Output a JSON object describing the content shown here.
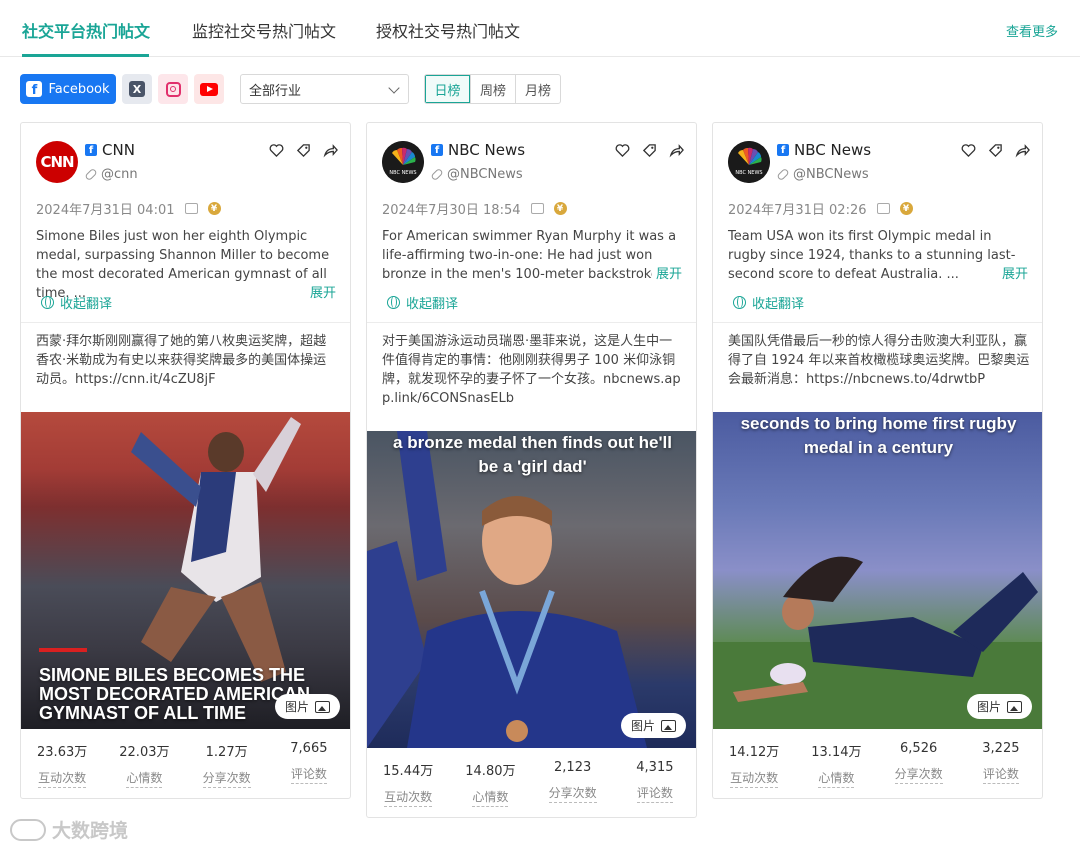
{
  "tabs": [
    {
      "label": "社交平台热门帖文",
      "active": true
    },
    {
      "label": "监控社交号热门帖文",
      "active": false
    },
    {
      "label": "授权社交号热门帖文",
      "active": false
    }
  ],
  "view_more": "查看更多",
  "platforms": {
    "facebook_label": "Facebook",
    "icons": [
      "facebook-icon",
      "x-icon",
      "instagram-icon",
      "youtube-icon"
    ],
    "selected": "Facebook"
  },
  "industry_select": {
    "value": "全部行业"
  },
  "periods": [
    "日榜",
    "周榜",
    "月榜"
  ],
  "active_period": "日榜",
  "posts": [
    {
      "account": "CNN",
      "avatar_text": "CNN",
      "handle": "@cnn",
      "datetime": "2024年7月31日 04:01",
      "text_en": "Simone Biles just won her eighth Olympic medal, surpassing Shannon Miller to become the most decorated American gymnast of all time. ...",
      "expand": "展开",
      "translate_toggle": "收起翻译",
      "text_zh": "西蒙·拜尔斯刚刚赢得了她的第八枚奥运奖牌，超越香农·米勒成为有史以来获得奖牌最多的美国体操运动员。https://cnn.it/4cZU8jF",
      "image_caption": "SIMONE BILES BECOMES THE MOST DECORATED AMERICAN GYMNAST OF ALL TIME",
      "image_badge": "图片",
      "stats": [
        {
          "value": "23.63万",
          "label": "互动次数"
        },
        {
          "value": "22.03万",
          "label": "心情数"
        },
        {
          "value": "1.27万",
          "label": "分享次数"
        },
        {
          "value": "7,665",
          "label": "评论数"
        }
      ]
    },
    {
      "account": "NBC News",
      "avatar_text": "NBC NEWS",
      "handle": "@NBCNews",
      "datetime": "2024年7月30日 18:54",
      "text_en": "For American swimmer Ryan Murphy it was a life-affirming two-in-one: He had just won bronze in the men's 100-meter backstroke when he f",
      "expand": "展开",
      "translate_toggle": "收起翻译",
      "text_zh": "对于美国游泳运动员瑞恩·墨菲来说，这是人生中一件值得肯定的事情：他刚刚获得男子 100 米仰泳铜牌，就发现怀孕的妻子怀了一个女孩。nbcnews.app.link/6CONSnasELb",
      "image_caption": "a bronze medal then finds out he'll be a 'girl dad'",
      "image_badge": "图片",
      "stats": [
        {
          "value": "15.44万",
          "label": "互动次数"
        },
        {
          "value": "14.80万",
          "label": "心情数"
        },
        {
          "value": "2,123",
          "label": "分享次数"
        },
        {
          "value": "4,315",
          "label": "评论数"
        }
      ]
    },
    {
      "account": "NBC News",
      "avatar_text": "NBC NEWS",
      "handle": "@NBCNews",
      "datetime": "2024年7月31日 02:26",
      "text_en": "Team USA won its first Olympic medal in rugby since 1924, thanks to a stunning last-second score to defeat Australia. ...",
      "expand": "展开",
      "translate_toggle": "收起翻译",
      "text_zh": "美国队凭借最后一秒的惊人得分击败澳大利亚队，赢得了自 1924 年以来首枚橄榄球奥运奖牌。巴黎奥运会最新消息：https://nbcnews.to/4drwtbP",
      "image_caption": "seconds to bring home first rugby medal in a century",
      "image_badge": "图片",
      "stats": [
        {
          "value": "14.12万",
          "label": "互动次数"
        },
        {
          "value": "13.14万",
          "label": "心情数"
        },
        {
          "value": "6,526",
          "label": "分享次数"
        },
        {
          "value": "3,225",
          "label": "评论数"
        }
      ]
    }
  ],
  "watermark": "大数跨境",
  "colors": {
    "accent": "#1aa596",
    "facebook": "#1877f2",
    "cnn": "#cc0000"
  }
}
